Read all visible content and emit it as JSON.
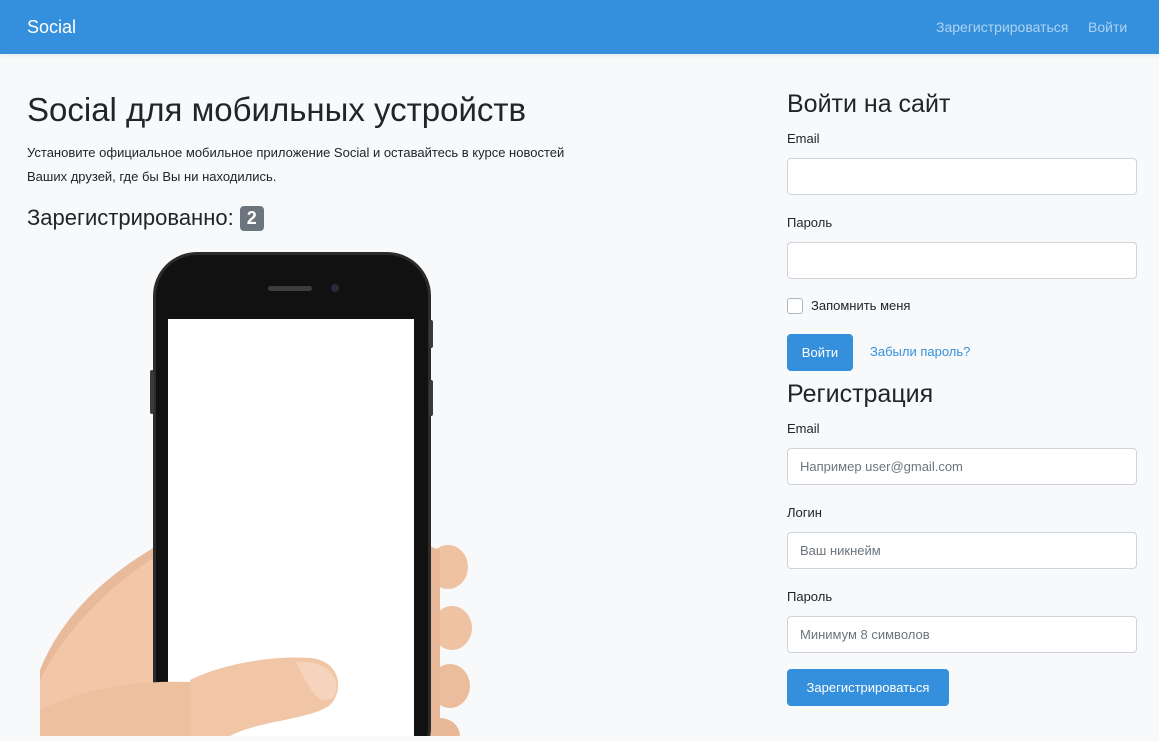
{
  "navbar": {
    "brand": "Social",
    "register_link": "Зарегистрироваться",
    "login_link": "Войти",
    "bg_color": "#3490dc"
  },
  "hero": {
    "title": "Social для мобильных устройств",
    "description": "Установите официальное мобильное приложение Social и оставайтесь в курсе новостей Ваших друзей, где бы Вы ни находились.",
    "registered_label": "Зарегистрированно:",
    "registered_count": "2"
  },
  "login_form": {
    "heading": "Войти на сайт",
    "email_label": "Email",
    "email_value": "",
    "password_label": "Пароль",
    "password_value": "",
    "remember_label": "Запомнить меня",
    "submit_label": "Войти",
    "forgot_label": "Забыли пароль?"
  },
  "register_form": {
    "heading": "Регистрация",
    "email_label": "Email",
    "email_placeholder": "Например user@gmail.com",
    "login_label": "Логин",
    "login_placeholder": "Ваш никнейм",
    "password_label": "Пароль",
    "password_placeholder": "Минимум 8 символов",
    "submit_label": "Зарегистрироваться"
  }
}
